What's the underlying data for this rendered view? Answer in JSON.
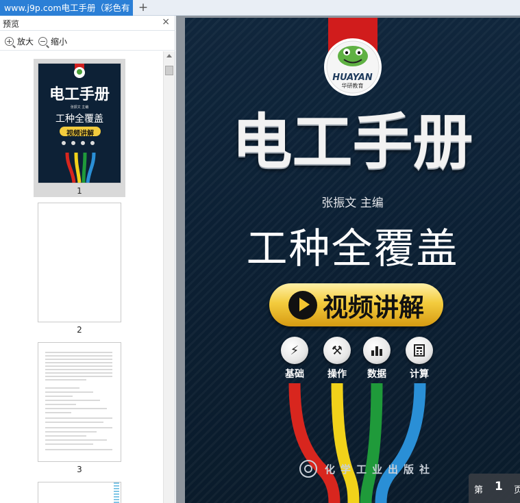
{
  "tab": {
    "title": "www.j9p.com电工手册（彩色有",
    "add_label": "+"
  },
  "sidebar": {
    "title": "预览",
    "close_label": "×",
    "zoom_in_label": "放大",
    "zoom_out_label": "缩小",
    "pages": [
      {
        "number": "1"
      },
      {
        "number": "2"
      },
      {
        "number": "3"
      }
    ]
  },
  "cover": {
    "logo_text": "HUAYAN",
    "logo_sub": "华研教育",
    "title": "电工手册",
    "author": "张振文  主编",
    "subtitle": "工种全覆盖",
    "badge": "视频讲解",
    "features": [
      {
        "icon": "lightning-icon",
        "label": "基础"
      },
      {
        "icon": "tools-icon",
        "label": "操作"
      },
      {
        "icon": "bar-chart-icon",
        "label": "数据"
      },
      {
        "icon": "calculator-icon",
        "label": "计算"
      }
    ],
    "publisher": "化学工业出版社",
    "wire_colors": [
      "#d8261e",
      "#f1d21a",
      "#1f9a3a",
      "#2a8fd6"
    ]
  },
  "thumbnail_1": {
    "title": "电工手册",
    "author": "张振文 主编",
    "subtitle": "工种全覆盖",
    "badge": "视频讲解"
  },
  "pager": {
    "prefix": "第",
    "page": "1",
    "suffix": "页"
  },
  "colors": {
    "tab_active": "#2b7fd6",
    "cover_bg": "#0b1c2d",
    "badge_gold": "#f3cc3e"
  }
}
